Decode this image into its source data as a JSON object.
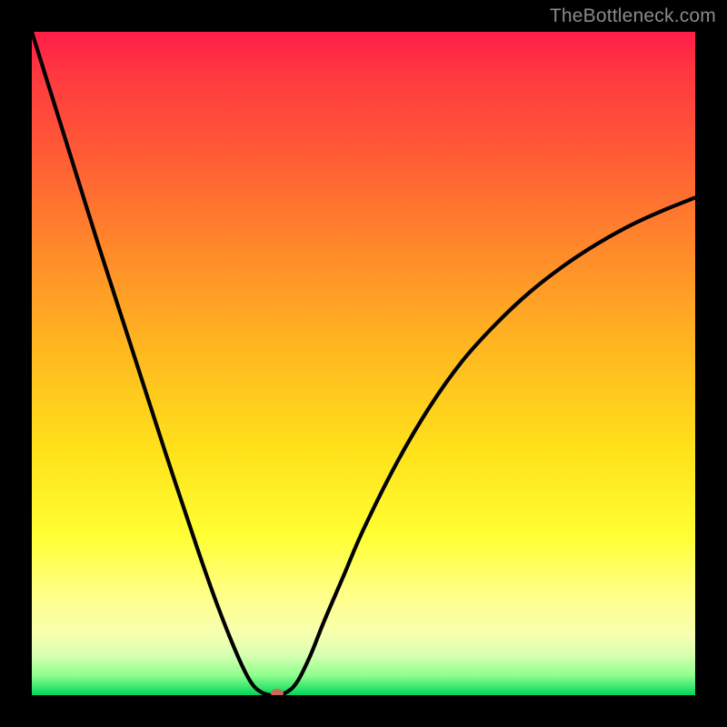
{
  "watermark": "TheBottleneck.com",
  "chart_data": {
    "type": "line",
    "title": "",
    "xlabel": "",
    "ylabel": "",
    "xlim": [
      0,
      100
    ],
    "ylim": [
      0,
      100
    ],
    "grid": false,
    "legend": false,
    "background_gradient": {
      "top_color": "#ff1d49",
      "mid_color": "#ffe11a",
      "bottom_color": "#00d65a",
      "meaning": "bottleneck severity (red=high, green=none)"
    },
    "series": [
      {
        "name": "bottleneck-curve",
        "color": "#000000",
        "x": [
          0,
          5,
          10,
          15,
          20,
          25,
          28,
          31,
          33,
          34.5,
          36,
          37,
          38.5,
          40,
          42,
          44,
          47,
          50,
          55,
          60,
          65,
          70,
          75,
          80,
          85,
          90,
          95,
          100
        ],
        "y": [
          100,
          84,
          68,
          52.5,
          37,
          22,
          13.5,
          6,
          2,
          0.5,
          0,
          0,
          0.5,
          2,
          6,
          11,
          18,
          25,
          35,
          43.5,
          50.5,
          56,
          60.7,
          64.6,
          67.9,
          70.7,
          73,
          75
        ]
      }
    ],
    "marker": {
      "name": "optimal-point",
      "x": 37,
      "y": 0,
      "color": "#c76a58"
    }
  }
}
